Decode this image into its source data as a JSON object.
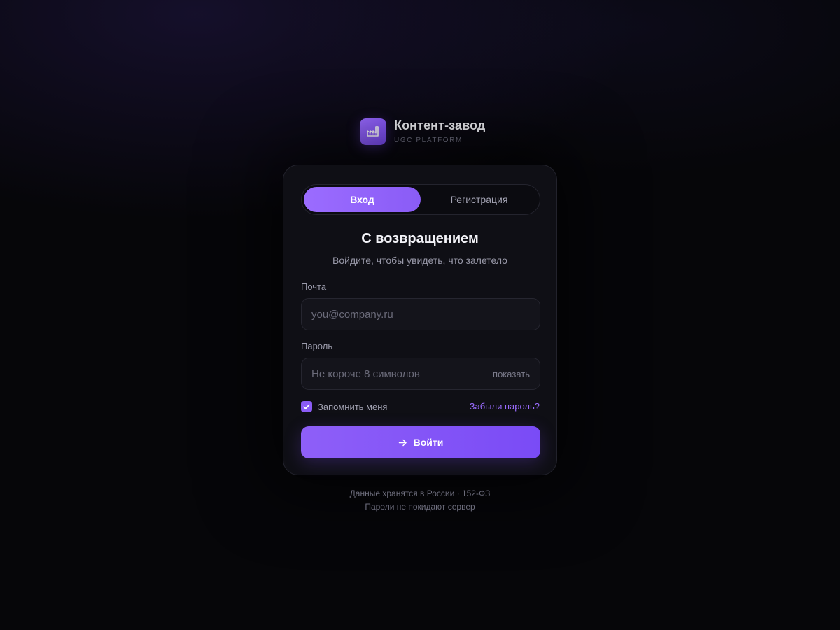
{
  "brand": {
    "name": "Контент-завод",
    "subtitle": "UGC PLATFORM",
    "logo_icon": "factory-icon",
    "accent": "#8b5cf6"
  },
  "tabs": [
    {
      "label": "Вход",
      "active": true
    },
    {
      "label": "Регистрация",
      "active": false
    }
  ],
  "heading": {
    "title": "С возвращением",
    "subtitle": "Войдите, чтобы увидеть, что залетело"
  },
  "form": {
    "email": {
      "label": "Почта",
      "placeholder": "you@company.ru",
      "value": ""
    },
    "password": {
      "label": "Пароль",
      "placeholder": "Не короче 8 символов",
      "value": "",
      "toggle_label": "показать"
    },
    "remember": {
      "label": "Запомнить меня",
      "checked": true
    },
    "forgot_label": "Забыли пароль?",
    "submit_label": "Войти",
    "submit_icon": "arrow-right-icon"
  },
  "footer": {
    "line1": "Данные хранятся в России · 152-ФЗ",
    "line2": "Пароли не покидают сервер"
  }
}
